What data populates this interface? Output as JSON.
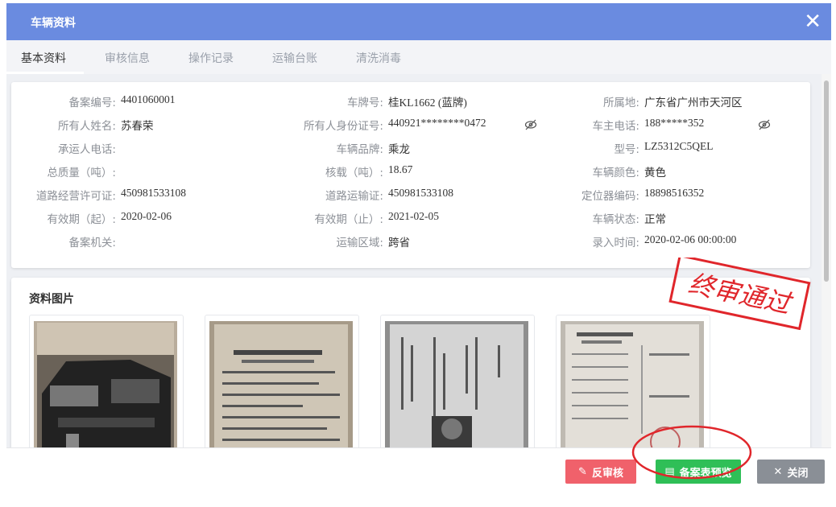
{
  "dialog": {
    "title": "车辆资料",
    "close_icon": "close-icon"
  },
  "tabs": [
    {
      "label": "基本资料",
      "active": true
    },
    {
      "label": "审核信息",
      "active": false
    },
    {
      "label": "操作记录",
      "active": false
    },
    {
      "label": "运输台账",
      "active": false
    },
    {
      "label": "清洗消毒",
      "active": false
    }
  ],
  "info": {
    "col1": [
      {
        "label": "备案编号:",
        "value": "4401060001"
      },
      {
        "label": "所有人姓名:",
        "value": "苏春荣"
      },
      {
        "label": "承运人电话:",
        "value": ""
      },
      {
        "label": "总质量（吨）:",
        "value": ""
      },
      {
        "label": "道路经营许可证:",
        "value": "450981533108"
      },
      {
        "label": "有效期（起）:",
        "value": "2020-02-06"
      },
      {
        "label": "备案机关:",
        "value": ""
      }
    ],
    "col2": [
      {
        "label": "车牌号:",
        "value": "桂KL1662 (蓝牌)"
      },
      {
        "label": "所有人身份证号:",
        "value": "440921********0472"
      },
      {
        "label": "车辆品牌:",
        "value": "乘龙"
      },
      {
        "label": "核载（吨）:",
        "value": "18.67"
      },
      {
        "label": "道路运输证:",
        "value": "450981533108"
      },
      {
        "label": "有效期（止）:",
        "value": "2021-02-05"
      },
      {
        "label": "运输区域:",
        "value": "跨省"
      }
    ],
    "col3": [
      {
        "label": "所属地:",
        "value": "广东省广州市天河区"
      },
      {
        "label": "车主电话:",
        "value": "188*****352"
      },
      {
        "label": "型号:",
        "value": "LZ5312C5QEL"
      },
      {
        "label": "车辆颜色:",
        "value": "黄色"
      },
      {
        "label": "定位器编码:",
        "value": "18898516352"
      },
      {
        "label": "车辆状态:",
        "value": "正常"
      },
      {
        "label": "录入时间:",
        "value": "2020-02-06 00:00:00"
      }
    ]
  },
  "images": {
    "title": "资料图片",
    "stamp_text": "终审通过"
  },
  "footer": {
    "unaudit_label": "反审核",
    "preview_label": "备案表预览",
    "close_label": "关闭"
  },
  "colors": {
    "header": "#6a8be0",
    "unaudit": "#f0616b",
    "preview": "#2fbf57",
    "close": "#8a8f96",
    "stamp": "#e0262b"
  }
}
